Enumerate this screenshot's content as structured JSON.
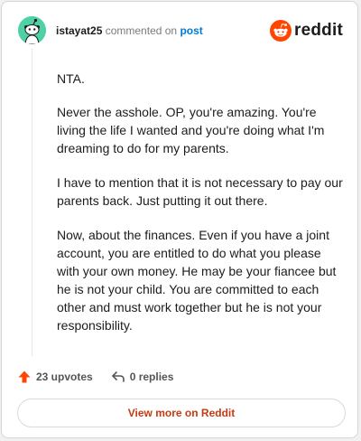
{
  "comment": {
    "username": "istayat25",
    "action_text": "commented on",
    "post_link": "post",
    "paragraphs": [
      "NTA.",
      "Never the asshole. OP, you're amazing. You're living the life I wanted and you're doing what I'm dreaming to do for my parents.",
      "I have to mention that it is not necessary to pay our parents back. Just putting it out there.",
      "Now, about the finances. Even if you have a joint account, you are entitled to do what you please with your own money. He may be your fiancee but he is not your child. You are committed to each other and must work together but he is not your responsibility."
    ]
  },
  "brand": {
    "wordmark": "reddit",
    "icon": "reddit-snoo-icon",
    "color": "#ff4500"
  },
  "actions": {
    "upvotes_label": "23 upvotes",
    "replies_label": "0 replies"
  },
  "footer": {
    "view_more_label": "View more on Reddit"
  },
  "colors": {
    "avatar": "#4fd1a3",
    "upvote": "#ff4500",
    "link": "#0079d3",
    "view_more_text": "#c43b12"
  },
  "icons": {
    "upvote": "upvote-arrow-icon",
    "reply": "reply-arrow-icon",
    "avatar": "snoo-avatar-icon"
  }
}
